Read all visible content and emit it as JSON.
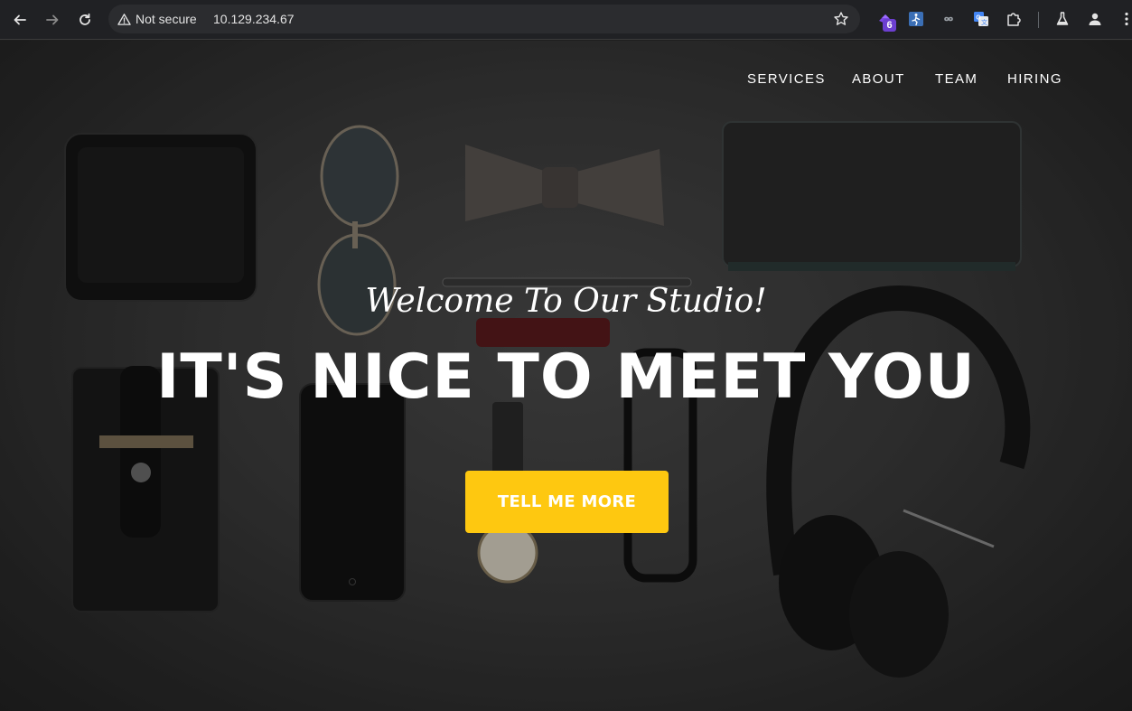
{
  "browser": {
    "security_label": "Not secure",
    "url": "10.129.234.67",
    "extension_badge": "6",
    "icons": {
      "back": "arrow-left-icon",
      "forward": "arrow-right-icon",
      "reload": "reload-icon",
      "warning": "warning-triangle-icon",
      "bookmark": "star-icon",
      "extensions": "puzzle-icon",
      "labs": "flask-icon",
      "profile": "person-icon",
      "menu": "more-vertical-icon"
    }
  },
  "nav": {
    "items": [
      {
        "label": "SERVICES"
      },
      {
        "label": "ABOUT"
      },
      {
        "label": "TEAM"
      },
      {
        "label": "HIRING"
      }
    ]
  },
  "hero": {
    "subheading": "Welcome To Our Studio!",
    "heading": "IT'S NICE TO MEET YOU",
    "cta_label": "TELL ME MORE"
  },
  "colors": {
    "accent": "#fec810",
    "chrome_bg": "#202124",
    "omnibox_bg": "#2b2c2f",
    "text": "#ffffff"
  }
}
